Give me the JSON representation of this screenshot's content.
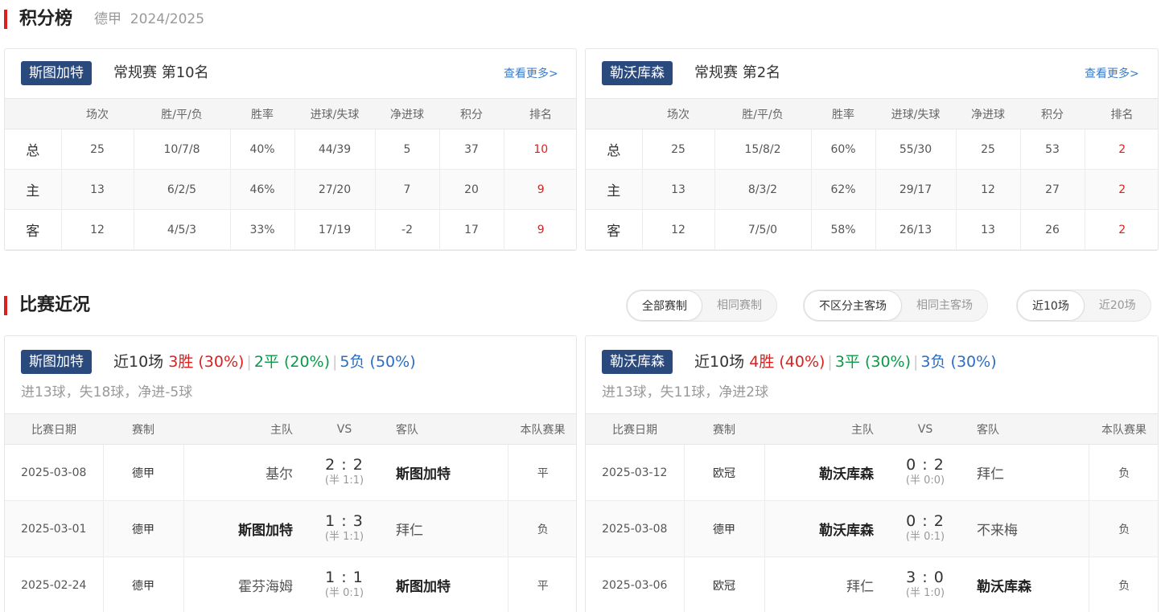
{
  "standings": {
    "title": "积分榜",
    "subtitle": "德甲  2024/2025",
    "headers": [
      "",
      "场次",
      "胜/平/负",
      "胜率",
      "进球/失球",
      "净进球",
      "积分",
      "排名"
    ],
    "more_label": "查看更多>",
    "teams": [
      {
        "name": "斯图加特",
        "info": "常规赛 第10名",
        "rows": [
          [
            "总",
            "25",
            "10/7/8",
            "40%",
            "44/39",
            "5",
            "37",
            "10"
          ],
          [
            "主",
            "13",
            "6/2/5",
            "46%",
            "27/20",
            "7",
            "20",
            "9"
          ],
          [
            "客",
            "12",
            "4/5/3",
            "33%",
            "17/19",
            "-2",
            "17",
            "9"
          ]
        ]
      },
      {
        "name": "勒沃库森",
        "info": "常规赛 第2名",
        "rows": [
          [
            "总",
            "25",
            "15/8/2",
            "60%",
            "55/30",
            "25",
            "53",
            "2"
          ],
          [
            "主",
            "13",
            "8/3/2",
            "62%",
            "29/17",
            "12",
            "27",
            "2"
          ],
          [
            "客",
            "12",
            "7/5/0",
            "58%",
            "26/13",
            "13",
            "26",
            "2"
          ]
        ]
      }
    ]
  },
  "recent": {
    "title": "比赛近况",
    "filters": [
      {
        "options": [
          "全部赛制",
          "相同赛制"
        ],
        "active": 0
      },
      {
        "options": [
          "不区分主客场",
          "相同主客场"
        ],
        "active": 0
      },
      {
        "options": [
          "近10场",
          "近20场"
        ],
        "active": 0
      }
    ],
    "headers": [
      "比赛日期",
      "赛制",
      "主队",
      "VS",
      "客队",
      "本队赛果"
    ],
    "teams": [
      {
        "name": "斯图加特",
        "span": "近10场",
        "wins": "3胜 (30%)",
        "draws": "2平 (20%)",
        "losses": "5负 (50%)",
        "goals": "进13球，失18球，净进-5球",
        "matches": [
          {
            "date": "2025-03-08",
            "comp": "德甲",
            "home": "基尔",
            "score": "2 : 2",
            "half": "(半 1:1)",
            "away": "斯图加特",
            "result": "平",
            "rtype": "d",
            "self": "away"
          },
          {
            "date": "2025-03-01",
            "comp": "德甲",
            "home": "斯图加特",
            "score": "1 : 3",
            "half": "(半 1:1)",
            "away": "拜仁",
            "result": "负",
            "rtype": "l",
            "self": "home"
          },
          {
            "date": "2025-02-24",
            "comp": "德甲",
            "home": "霍芬海姆",
            "score": "1 : 1",
            "half": "(半 0:1)",
            "away": "斯图加特",
            "result": "平",
            "rtype": "d",
            "self": "away"
          }
        ]
      },
      {
        "name": "勒沃库森",
        "span": "近10场",
        "wins": "4胜 (40%)",
        "draws": "3平 (30%)",
        "losses": "3负 (30%)",
        "goals": "进13球，失11球，净进2球",
        "matches": [
          {
            "date": "2025-03-12",
            "comp": "欧冠",
            "home": "勒沃库森",
            "score": "0 : 2",
            "half": "(半 0:0)",
            "away": "拜仁",
            "result": "负",
            "rtype": "l",
            "self": "home"
          },
          {
            "date": "2025-03-08",
            "comp": "德甲",
            "home": "勒沃库森",
            "score": "0 : 2",
            "half": "(半 0:1)",
            "away": "不来梅",
            "result": "负",
            "rtype": "l",
            "self": "home"
          },
          {
            "date": "2025-03-06",
            "comp": "欧冠",
            "home": "拜仁",
            "score": "3 : 0",
            "half": "(半 1:0)",
            "away": "勒沃库森",
            "result": "负",
            "rtype": "l",
            "self": "away"
          }
        ]
      }
    ]
  }
}
